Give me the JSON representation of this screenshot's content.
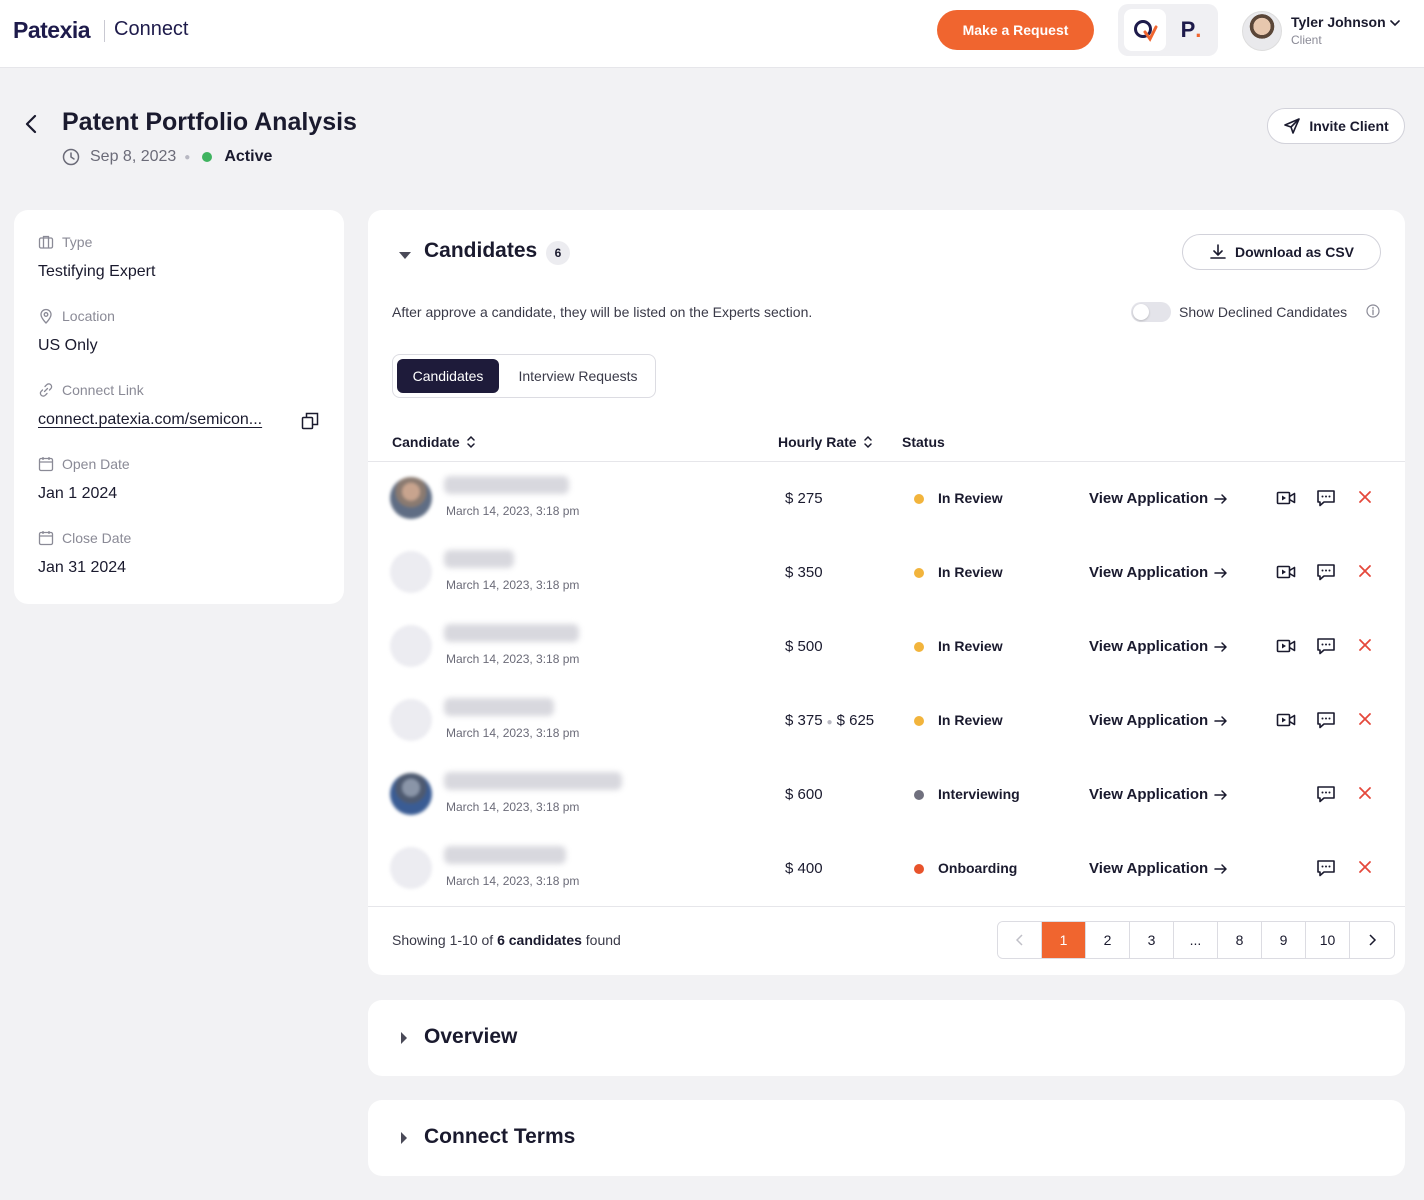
{
  "header": {
    "brand": "Patexia",
    "product": "Connect",
    "request_button": "Make a Request",
    "app_p_letter": "P",
    "user": {
      "name": "Tyler Johnson",
      "role": "Client"
    }
  },
  "page": {
    "title": "Patent Portfolio Analysis",
    "date": "Sep 8, 2023",
    "status": "Active",
    "invite_button": "Invite Client"
  },
  "details": {
    "type_label": "Type",
    "type_value": "Testifying Expert",
    "location_label": "Location",
    "location_value": "US Only",
    "link_label": "Connect Link",
    "link_value": "connect.patexia.com/semicon...",
    "open_label": "Open Date",
    "open_value": "Jan 1 2024",
    "close_label": "Close Date",
    "close_value": "Jan 31 2024"
  },
  "candidates": {
    "title": "Candidates",
    "count": "6",
    "csv_button": "Download as CSV",
    "info": "After approve a candidate, they will be listed on the Experts section.",
    "toggle_label": "Show Declined Candidates",
    "tabs": [
      "Candidates",
      "Interview Requests"
    ],
    "columns": {
      "candidate": "Candidate",
      "rate": "Hourly Rate",
      "status": "Status"
    },
    "view_label": "View Application",
    "rows": [
      {
        "date": "March 14, 2023, 3:18 pm",
        "rate": "$ 275",
        "rate2": "",
        "status": "In Review",
        "status_color": "#f2b43c"
      },
      {
        "date": "March 14, 2023, 3:18 pm",
        "rate": "$ 350",
        "rate2": "",
        "status": "In Review",
        "status_color": "#f2b43c"
      },
      {
        "date": "March 14, 2023, 3:18 pm",
        "rate": "$ 500",
        "rate2": "",
        "status": "In Review",
        "status_color": "#f2b43c"
      },
      {
        "date": "March 14, 2023, 3:18 pm",
        "rate": "$ 375",
        "rate2": "$ 625",
        "status": "In Review",
        "status_color": "#f2b43c"
      },
      {
        "date": "March 14, 2023, 3:18 pm",
        "rate": "$ 600",
        "rate2": "",
        "status": "Interviewing",
        "status_color": "#70707e"
      },
      {
        "date": "March 14, 2023, 3:18 pm",
        "rate": "$ 400",
        "rate2": "",
        "status": "Onboarding",
        "status_color": "#e8532b"
      }
    ],
    "showing_prefix": "Showing 1-10 of",
    "showing_count": "6 candidates",
    "showing_suffix": "found",
    "pages": [
      "1",
      "2",
      "3",
      "...",
      "8",
      "9",
      "10"
    ]
  },
  "sections": {
    "overview": "Overview",
    "terms": "Connect Terms"
  },
  "colors": {
    "accent": "#f0652f",
    "dark": "#1e1b3a",
    "active_green": "#3fb35f",
    "decline_red": "#e5483b"
  }
}
